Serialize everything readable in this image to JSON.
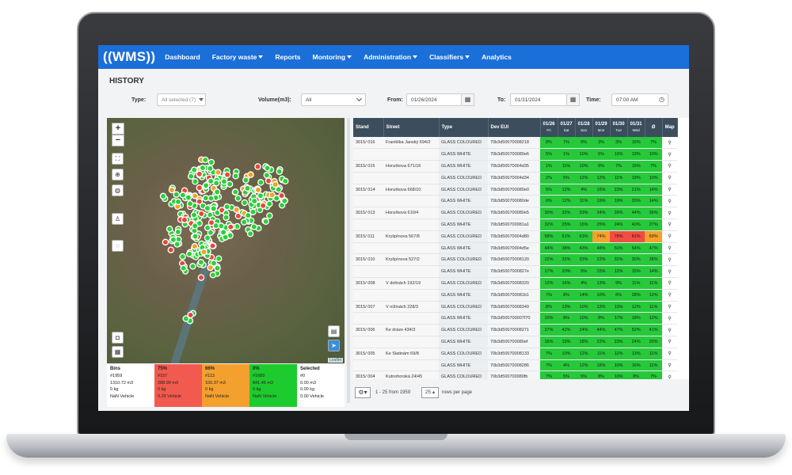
{
  "app": {
    "logo": "((WMS))",
    "nav": [
      {
        "label": "Dashboard",
        "caret": false
      },
      {
        "label": "Factory waste",
        "caret": true
      },
      {
        "label": "Reports",
        "caret": false
      },
      {
        "label": "Montoring",
        "caret": true
      },
      {
        "label": "Administration",
        "caret": true
      },
      {
        "label": "Classifiers",
        "caret": true
      },
      {
        "label": "Analytics",
        "caret": false
      }
    ]
  },
  "page": {
    "title": "HISTORY"
  },
  "filters": {
    "type_label": "Type:",
    "type_value": "All selected (7)",
    "volume_label": "Volume(m3):",
    "volume_value": "All",
    "from_label": "From:",
    "from_value": "01/26/2024",
    "to_label": "To:",
    "to_value": "01/31/2024",
    "time_label": "Time:",
    "time_value": "07:00 AM"
  },
  "map": {
    "zoom_in": "+",
    "zoom_out": "−",
    "attribution": "Leaflet",
    "tool_icons": [
      "fullscreen-icon",
      "bin-icon",
      "layers-icon",
      "person-icon",
      "comment-icon",
      "camera-icon",
      "grid-icon",
      "layer-toggle-icon",
      "locate-icon"
    ]
  },
  "summary": [
    {
      "head": "Bins",
      "count": "#1959",
      "volume": "1310.72 m3",
      "weight": "0 kg",
      "vehicle": "NaN Vehicle"
    },
    {
      "head": "75%",
      "count": "#157",
      "volume": "288.99 m3",
      "weight": "0 kg",
      "vehicle": "0.29 Vehicle"
    },
    {
      "head": "66%",
      "count": "#113",
      "volume": "100.37 m3",
      "weight": "0 kg",
      "vehicle": "NaN Vehicle"
    },
    {
      "head": "0%",
      "count": "#1689",
      "volume": "841.46 m3",
      "weight": "0 kg",
      "vehicle": "NaN Vehicle"
    },
    {
      "head": "Selected",
      "count": "#0",
      "volume": "0.00 m3",
      "weight": "0.00 kg",
      "vehicle": "0.00 Vehicle"
    }
  ],
  "table": {
    "columns": [
      "Stand",
      "Street",
      "Type",
      "Dev EUI"
    ],
    "days": [
      {
        "date": "01/26",
        "dow": "Fri"
      },
      {
        "date": "01/27",
        "dow": "Sat"
      },
      {
        "date": "01/28",
        "dow": "Sun"
      },
      {
        "date": "01/29",
        "dow": "Mon"
      },
      {
        "date": "01/30",
        "dow": "Tue"
      },
      {
        "date": "01/31",
        "dow": "Wed"
      }
    ],
    "avg_col": "Ø",
    "map_col": "Map",
    "rows": [
      {
        "stand": "3015/ 016",
        "street": "Františka Janský 694/2",
        "type": "GLASS COLOURED",
        "dev": "70b3d50070008218",
        "vals": [
          "8%",
          "7%",
          "6%",
          "3%",
          "3%",
          "16%"
        ],
        "avg": "7%",
        "colors": [
          "g",
          "g",
          "g",
          "g",
          "g",
          "g",
          "g"
        ]
      },
      {
        "stand": "",
        "street": "",
        "type": "GLASS WHITE",
        "dev": "70b3d500700080e6",
        "vals": [
          "5%",
          "1%",
          "10%",
          "5%",
          "19%",
          "19%"
        ],
        "avg": "10%",
        "colors": [
          "g",
          "g",
          "g",
          "g",
          "g",
          "g",
          "g"
        ]
      },
      {
        "stand": "3015/ 015",
        "street": "Honzíkova 671/16",
        "type": "GLASS WHITE",
        "dev": "70b3d50070004d35",
        "vals": [
          "1%",
          "11%",
          "10%",
          "6%",
          "7%",
          "15%"
        ],
        "avg": "7%",
        "colors": [
          "g",
          "g",
          "g",
          "g",
          "g",
          "g",
          "g"
        ]
      },
      {
        "stand": "",
        "street": "",
        "type": "GLASS COLOURED",
        "dev": "70b3d50070004d34",
        "vals": [
          "2%",
          "5%",
          "12%",
          "12%",
          "11%",
          "19%"
        ],
        "avg": "10%",
        "colors": [
          "g",
          "g",
          "g",
          "g",
          "g",
          "g",
          "g"
        ]
      },
      {
        "stand": "3015/ 014",
        "street": "Honzíkova 668/10",
        "type": "GLASS COLOURED",
        "dev": "70b3d500700080e0",
        "vals": [
          "5%",
          "12%",
          "4%",
          "16%",
          "23%",
          "21%"
        ],
        "avg": "14%",
        "colors": [
          "g",
          "g",
          "g",
          "g",
          "g",
          "g",
          "g"
        ]
      },
      {
        "stand": "",
        "street": "",
        "type": "GLASS WHITE",
        "dev": "70b3d500700080de",
        "vals": [
          "6%",
          "12%",
          "11%",
          "19%",
          "19%",
          "20%"
        ],
        "avg": "14%",
        "colors": [
          "g",
          "g",
          "g",
          "g",
          "g",
          "g",
          "g"
        ]
      },
      {
        "stand": "3015/ 013",
        "street": "Honzíkova 610/4",
        "type": "GLASS COLOURED",
        "dev": "70b3d500700080e5",
        "vals": [
          "30%",
          "32%",
          "33%",
          "34%",
          "39%",
          "44%"
        ],
        "avg": "36%",
        "colors": [
          "g",
          "g",
          "g",
          "g",
          "g",
          "g",
          "g"
        ]
      },
      {
        "stand": "",
        "street": "",
        "type": "GLASS WHITE",
        "dev": "70b3d500700081a1",
        "vals": [
          "32%",
          "25%",
          "16%",
          "25%",
          "24%",
          "40%"
        ],
        "avg": "27%",
        "colors": [
          "g",
          "g",
          "g",
          "g",
          "g",
          "g",
          "g"
        ]
      },
      {
        "stand": "3015/ 011",
        "street": "Kryšpínova 567/8",
        "type": "GLASS COLOURED",
        "dev": "70b3d50070004d80",
        "vals": [
          "58%",
          "61%",
          "63%",
          "74%",
          "78%",
          "81%"
        ],
        "avg": "69%",
        "colors": [
          "g",
          "g",
          "g",
          "o",
          "r",
          "r",
          "o"
        ]
      },
      {
        "stand": "",
        "street": "",
        "type": "GLASS WHITE",
        "dev": "70b3d50070004d5e",
        "vals": [
          "44%",
          "38%",
          "43%",
          "48%",
          "50%",
          "54%"
        ],
        "avg": "47%",
        "colors": [
          "g",
          "g",
          "g",
          "g",
          "g",
          "g",
          "g"
        ]
      },
      {
        "stand": "3015/ 010",
        "street": "Kryšpínova 527/2",
        "type": "GLASS COLOURED",
        "dev": "70b3d50070008120",
        "vals": [
          "22%",
          "32%",
          "33%",
          "22%",
          "32%",
          "30%"
        ],
        "avg": "28%",
        "colors": [
          "g",
          "g",
          "g",
          "g",
          "g",
          "g",
          "g"
        ]
      },
      {
        "stand": "",
        "street": "",
        "type": "GLASS WHITE",
        "dev": "70b3d5007000827e",
        "vals": [
          "17%",
          "20%",
          "5%",
          "15%",
          "12%",
          "15%"
        ],
        "avg": "14%",
        "colors": [
          "g",
          "g",
          "g",
          "g",
          "g",
          "g",
          "g"
        ]
      },
      {
        "stand": "3015/ 008",
        "street": "V dolinách 192/19",
        "type": "GLASS COLOURED",
        "dev": "70b3d50070008320",
        "vals": [
          "12%",
          "16%",
          "4%",
          "13%",
          "9%",
          "11%"
        ],
        "avg": "11%",
        "colors": [
          "g",
          "g",
          "g",
          "g",
          "g",
          "g",
          "g"
        ]
      },
      {
        "stand": "",
        "street": "",
        "type": "GLASS WHITE",
        "dev": "70b3d500700081b1",
        "vals": [
          "7%",
          "8%",
          "14%",
          "10%",
          "6%",
          "28%"
        ],
        "avg": "12%",
        "colors": [
          "g",
          "g",
          "g",
          "g",
          "g",
          "g",
          "g"
        ]
      },
      {
        "stand": "3015/ 007",
        "street": "V nížinách 228/3",
        "type": "GLASS COLOURED",
        "dev": "70b3d50070008349",
        "vals": [
          "8%",
          "13%",
          "10%",
          "13%",
          "13%",
          "12%"
        ],
        "avg": "11%",
        "colors": [
          "g",
          "g",
          "g",
          "g",
          "g",
          "g",
          "g"
        ]
      },
      {
        "stand": "",
        "street": "",
        "type": "GLASS WHITE",
        "dev": "70b3d500700007f70",
        "vals": [
          "10%",
          "8%",
          "10%",
          "8%",
          "17%",
          "18%"
        ],
        "avg": "12%",
        "colors": [
          "g",
          "g",
          "g",
          "g",
          "g",
          "g",
          "g"
        ]
      },
      {
        "stand": "3015/ 006",
        "street": "Ke dráze 434/3",
        "type": "GLASS COLOURED",
        "dev": "70b3d50070008271",
        "vals": [
          "37%",
          "42%",
          "24%",
          "44%",
          "47%",
          "52%"
        ],
        "avg": "41%",
        "colors": [
          "g",
          "g",
          "g",
          "g",
          "g",
          "g",
          "g"
        ]
      },
      {
        "stand": "",
        "street": "",
        "type": "GLASS WHITE",
        "dev": "70b3d500700080ef",
        "vals": [
          "16%",
          "19%",
          "18%",
          "22%",
          "23%",
          "24%"
        ],
        "avg": "20%",
        "colors": [
          "g",
          "g",
          "g",
          "g",
          "g",
          "g",
          "g"
        ]
      },
      {
        "stand": "3015/ 005",
        "street": "Ke Slatinám 69/8",
        "type": "GLASS COLOURED",
        "dev": "70b3d50070008133",
        "vals": [
          "7%",
          "10%",
          "12%",
          "11%",
          "12%",
          "13%"
        ],
        "avg": "11%",
        "colors": [
          "g",
          "g",
          "g",
          "g",
          "g",
          "g",
          "g"
        ]
      },
      {
        "stand": "",
        "street": "",
        "type": "GLASS WHITE",
        "dev": "70b3d50070008286",
        "vals": [
          "7%",
          "4%",
          "12%",
          "18%",
          "10%",
          "16%"
        ],
        "avg": "11%",
        "colors": [
          "g",
          "g",
          "g",
          "g",
          "g",
          "g",
          "g"
        ]
      },
      {
        "stand": "3015/ 004",
        "street": "Kutnohorská 24/45",
        "type": "GLASS COLOURED",
        "dev": "70b3d500700080fb",
        "vals": [
          "7%",
          "5%",
          "5%",
          "8%",
          "10%",
          "8%"
        ],
        "avg": "7%",
        "colors": [
          "g",
          "g",
          "g",
          "g",
          "g",
          "g",
          "g"
        ]
      }
    ]
  },
  "pager": {
    "range": "1 - 25 from 1959",
    "size": "25",
    "label": "rows per page"
  }
}
